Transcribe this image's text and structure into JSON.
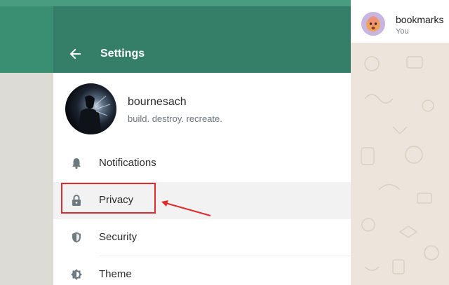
{
  "header": {
    "title": "Settings"
  },
  "profile": {
    "name": "bournesach",
    "status": "build. destroy. recreate."
  },
  "menu": {
    "items": [
      {
        "label": "Notifications",
        "icon": "bell-icon"
      },
      {
        "label": "Privacy",
        "icon": "lock-icon",
        "selected": true
      },
      {
        "label": "Security",
        "icon": "shield-icon"
      },
      {
        "label": "Theme",
        "icon": "theme-icon"
      }
    ]
  },
  "chat": {
    "name": "bookmarks",
    "subtitle": "You",
    "avatar_icon": "emoji-avatar-icon"
  },
  "colors": {
    "header_green": "#357f69",
    "top_band_green": "#3a8f72",
    "annotation_red": "#e22a2a",
    "selected_row": "#f2f2f2"
  }
}
